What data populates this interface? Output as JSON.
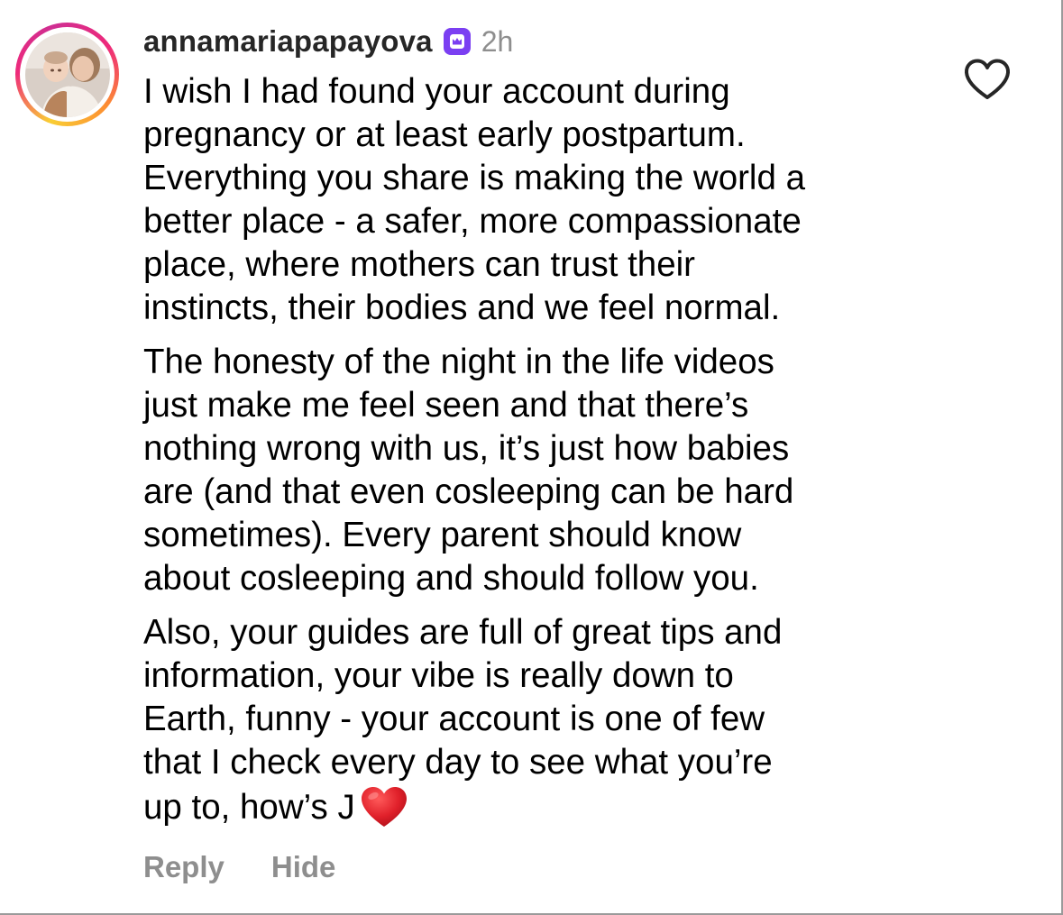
{
  "comment": {
    "username": "annamariapapayova",
    "badge_icon": "crown-icon",
    "badge_color": "#7b3ff2",
    "time": "2h",
    "like_icon": "heart-outline-icon",
    "paragraphs": [
      {
        "lines": [
          "I wish I had found your account during",
          "pregnancy or at least early postpartum.",
          "Everything you share is making the world a",
          "better place - a safer, more compassionate",
          "place, where mothers can trust their",
          "instincts, their bodies and we feel normal."
        ]
      },
      {
        "lines": [
          "The honesty of the night in the life videos",
          "just make me feel seen and that there’s",
          "nothing wrong with us, it’s just how babies",
          "are (and that even cosleeping can be hard",
          "sometimes). Every parent should know",
          "about cosleeping and should follow you."
        ]
      },
      {
        "lines": [
          "Also, your guides are full of great tips and",
          "information, your vibe is really down to",
          "Earth, funny - your account is one of few",
          "that I check every day to see what you’re",
          "up to, how’s J"
        ],
        "emoji_icon": "red-heart-emoji-icon"
      }
    ],
    "actions": {
      "reply": "Reply",
      "hide": "Hide"
    }
  },
  "colors": {
    "username": "#262626",
    "secondary": "#8e8e8e",
    "emoji_heart": "#e0202a"
  }
}
